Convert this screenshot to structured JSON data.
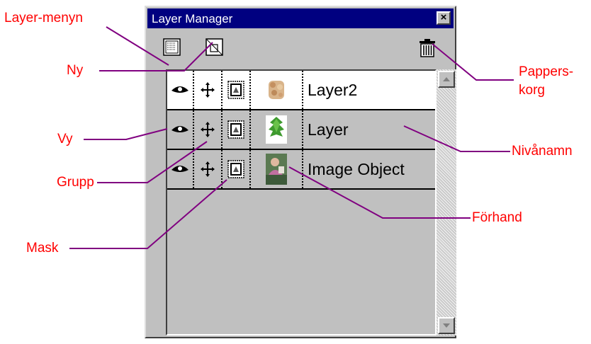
{
  "window": {
    "title": "Layer Manager",
    "close_symbol": "×",
    "toolbar": [
      {
        "icon": "layer-menu-icon"
      },
      {
        "icon": "new-layer-icon"
      },
      {
        "icon": "trash-icon"
      }
    ]
  },
  "layers": [
    {
      "name": "Layer2",
      "selected": true,
      "thumb": "texture-thumbnail"
    },
    {
      "name": "Layer",
      "selected": false,
      "thumb": "green-leaf-thumbnail"
    },
    {
      "name": "Image Object",
      "selected": false,
      "thumb": "photo-thumbnail"
    }
  ],
  "callouts": {
    "layer_menu": "Layer-menyn",
    "new": "Ny",
    "view": "Vy",
    "group": "Grupp",
    "mask": "Mask",
    "trash_line1": "Pappers-",
    "trash_line2": "korg",
    "layer_name": "Nivånamn",
    "preview": "Förhand"
  },
  "colors": {
    "callout_text": "#ff0000",
    "callout_line": "#800080",
    "titlebar": "#000080"
  }
}
